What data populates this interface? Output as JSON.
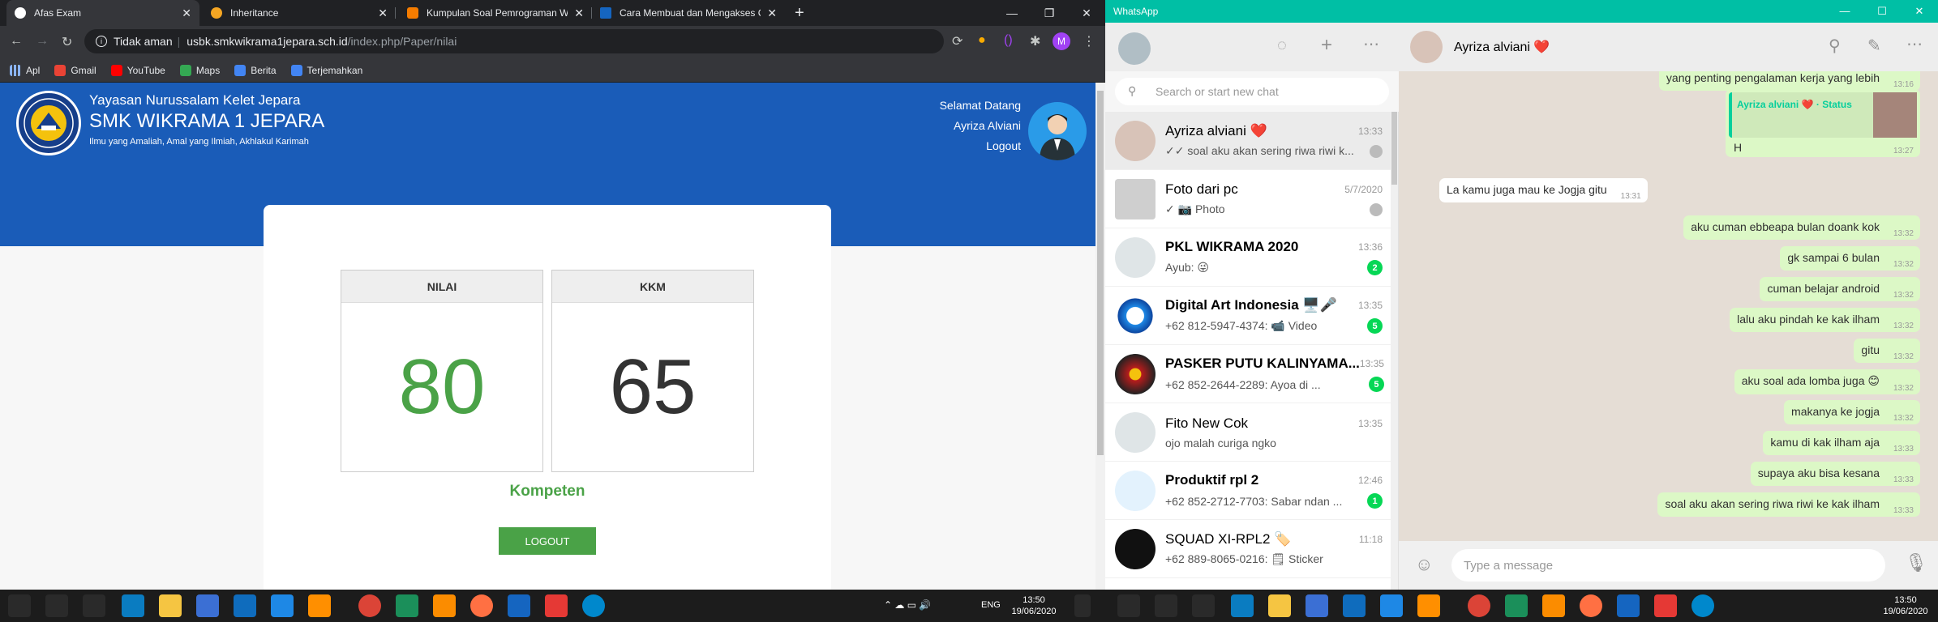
{
  "chrome": {
    "tabs": [
      {
        "title": "Afas Exam",
        "color": "#ffffff"
      },
      {
        "title": "Inheritance",
        "color": "#f5a623"
      },
      {
        "title": "Kumpulan Soal Pemrograman W",
        "color": "#f57c00"
      },
      {
        "title": "Cara Membuat dan Mengakses C",
        "color": "#1565c0"
      }
    ],
    "new_tab": "+",
    "address": {
      "security": "Tidak aman",
      "domain": "usbk.smkwikrama1jepara.sch.id",
      "path": "/index.php/Paper/nilai"
    },
    "profile_initial": "M",
    "bookmarks": [
      {
        "label": "Apl",
        "color": "#e8eaed"
      },
      {
        "label": "Gmail",
        "color": "#ea4335"
      },
      {
        "label": "YouTube",
        "color": "#ff0000"
      },
      {
        "label": "Maps",
        "color": "#34a853"
      },
      {
        "label": "Berita",
        "color": "#4285f4"
      },
      {
        "label": "Terjemahkan",
        "color": "#4285f4"
      }
    ]
  },
  "exam_page": {
    "org_line1": "Yayasan Nurussalam Kelet Jepara",
    "org_line2": "SMK WIKRAMA 1 JEPARA",
    "org_line3": "Ilmu yang Amaliah, Amal yang Ilmiah, Akhlakul Karimah",
    "welcome": "Selamat Datang",
    "user": "Ayriza Alviani",
    "logout_link": "Logout",
    "score_label": "NILAI",
    "score_value": "80",
    "kkm_label": "KKM",
    "kkm_value": "65",
    "result": "Kompeten",
    "logout_button": "LOGOUT",
    "colors": {
      "banner": "#1a5cb8",
      "pass": "#4aa247"
    }
  },
  "whatsapp": {
    "window_title": "WhatsApp",
    "search_placeholder": "Search or start new chat",
    "chats": [
      {
        "name": "Ayriza alviani ❤️",
        "time": "13:33",
        "preview": "✓✓ soal aku akan sering riwa riwi k...",
        "badge": "",
        "avatar": "#d8c3b8"
      },
      {
        "name": "Foto dari pc",
        "time": "5/7/2020",
        "preview": "✓ 📷 Photo",
        "badge": "",
        "avatar": "#cfcfcf"
      },
      {
        "name": "PKL WIKRAMA 2020",
        "time": "13:36",
        "preview": "Ayub: 😜",
        "badge": "2",
        "avatar": "#dfe5e7"
      },
      {
        "name": "Digital Art Indonesia 🖥️🎤",
        "time": "13:35",
        "preview": "+62 812-5947-4374: 📹 Video",
        "badge": "5",
        "avatar": "#1e88e5"
      },
      {
        "name": "PASKER PUTU KALINYAMA...",
        "time": "13:35",
        "preview": "+62 852-2644-2289: Ayoa di ...",
        "badge": "5",
        "avatar": "#b71c1c"
      },
      {
        "name": "Fito New Cok",
        "time": "13:35",
        "preview": "ojo malah curiga ngko",
        "badge": "",
        "avatar": "#dfe5e7"
      },
      {
        "name": "Produktif rpl 2",
        "time": "12:46",
        "preview": "+62 852-2712-7703: Sabar ndan ...",
        "badge": "1",
        "avatar": "#e3f2fd"
      },
      {
        "name": "SQUAD XI-RPL2 🏷️",
        "time": "11:18",
        "preview": "+62 889-8065-0216: 🗒 Sticker",
        "badge": "",
        "avatar": "#111111"
      }
    ],
    "contact_name": "Ayriza alviani ❤️",
    "messages": [
      {
        "dir": "out",
        "text": "yang penting pengalaman kerja yang lebih",
        "time": "13:16"
      },
      {
        "dir": "out",
        "text": "H",
        "time": "13:27",
        "status_reply": "Ayriza alviani ❤️ · Status"
      },
      {
        "dir": "in",
        "text": "La kamu juga mau ke Jogja gitu",
        "time": "13:31"
      },
      {
        "dir": "out",
        "text": "aku cuman ebbeapa bulan doank kok",
        "time": "13:32"
      },
      {
        "dir": "out",
        "text": "gk sampai 6 bulan",
        "time": "13:32"
      },
      {
        "dir": "out",
        "text": "cuman belajar android",
        "time": "13:32"
      },
      {
        "dir": "out",
        "text": "lalu aku pindah ke kak ilham",
        "time": "13:32"
      },
      {
        "dir": "out",
        "text": "gitu",
        "time": "13:32"
      },
      {
        "dir": "out",
        "text": "aku soal ada lomba juga 😊",
        "time": "13:32"
      },
      {
        "dir": "out",
        "text": "makanya ke jogja",
        "time": "13:32"
      },
      {
        "dir": "out",
        "text": "kamu di kak ilham aja",
        "time": "13:33"
      },
      {
        "dir": "out",
        "text": "supaya aku bisa kesana",
        "time": "13:33"
      },
      {
        "dir": "out",
        "text": "soal aku akan sering riwa riwi ke kak ilham",
        "time": "13:33"
      }
    ],
    "message_placeholder": "Type a message"
  },
  "taskbar": {
    "left_clock_time": "13:50",
    "left_clock_date": "19/06/2020",
    "right_clock_time": "13:50",
    "right_clock_date": "19/06/2020",
    "lang": "ENG"
  }
}
